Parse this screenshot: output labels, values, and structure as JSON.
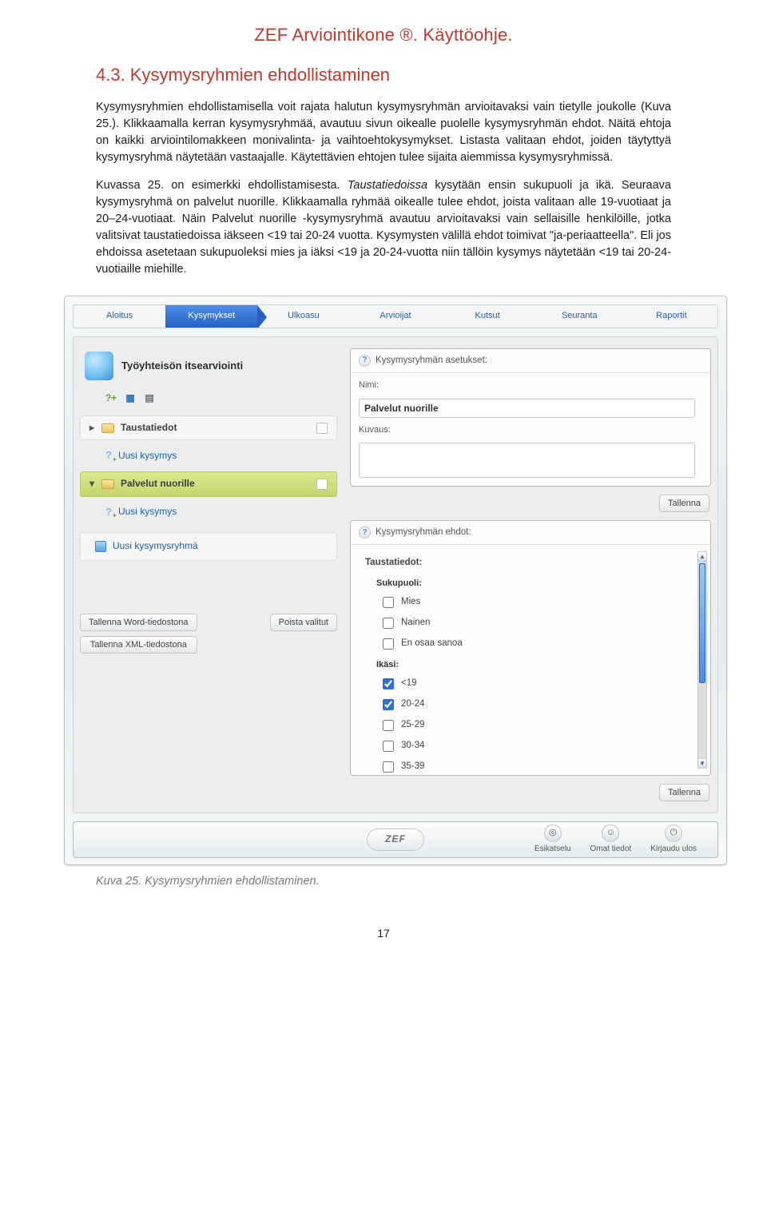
{
  "document": {
    "header": "ZEF Arviointikone ®. Käyttöohje."
  },
  "section": {
    "heading": "4.3. Kysymysryhmien ehdollistaminen",
    "para1": "Kysymysryhmien ehdollistamisella voit rajata halutun kysymysryhmän arvioitavaksi vain tietylle joukolle (Kuva 25.). Klikkaamalla kerran kysymysryhmää, avautuu sivun oikealle puolelle kysymysryhmän ehdot. Näitä ehtoja on kaikki arviointilomakkeen monivalinta- ja vaihtoehtokysymykset. Listasta valitaan ehdot, joiden täytyttyä kysymysryhmä näytetään vastaajalle. Käytettävien ehtojen tulee sijaita aiemmissa kysymysryhmissä.",
    "para2a": "Kuvassa 25. on esimerkki ehdollistamisesta. ",
    "para2_italic": "Taustatiedoissa",
    "para2b": " kysytään ensin sukupuoli ja ikä. Seuraava kysymysryhmä on palvelut nuorille. Klikkaamalla ryhmää oikealle tulee ehdot, joista valitaan alle 19-vuotiaat ja 20–24-vuotiaat. Näin Palvelut nuorille -kysymysryhmä avautuu arvioitavaksi vain sellaisille henkilöille, jotka valitsivat taustatiedoissa iäkseen <19 tai 20-24 vuotta. Kysymysten välillä ehdot toimivat \"ja-periaatteella\". Eli jos ehdoissa asetetaan sukupuoleksi mies ja iäksi <19 ja 20-24-vuotta niin tällöin kysymys näytetään <19 tai 20-24-vuotiaille miehille."
  },
  "screenshot": {
    "tabs": [
      "Aloitus",
      "Kysymykset",
      "Ulkoasu",
      "Arvioijat",
      "Kutsut",
      "Seuranta",
      "Raportit"
    ],
    "activeTab": 1,
    "evaluationTitle": "Työyhteisön itsearviointi",
    "groups": {
      "g1": "Taustatiedot",
      "g2": "Palvelut nuorille"
    },
    "newQuestion": "Uusi kysymys",
    "newGroup": "Uusi kysymysryhmä",
    "buttons": {
      "saveWord": "Tallenna Word-tiedostona",
      "saveXml": "Tallenna XML-tiedostona",
      "deleteSelected": "Poista valitut",
      "save": "Tallenna"
    },
    "settingsPanel": {
      "title": "Kysymysryhmän asetukset:",
      "nameLabel": "Nimi:",
      "nameValue": "Palvelut nuorille",
      "descLabel": "Kuvaus:"
    },
    "conditionsPanel": {
      "title": "Kysymysryhmän ehdot:",
      "sectionLabel": "Taustatiedot:",
      "gender": {
        "label": "Sukupuoli:",
        "options": [
          {
            "label": "Mies",
            "checked": false
          },
          {
            "label": "Nainen",
            "checked": false
          },
          {
            "label": "En osaa sanoa",
            "checked": false
          }
        ]
      },
      "age": {
        "label": "Ikäsi:",
        "options": [
          {
            "label": "<19",
            "checked": true
          },
          {
            "label": "20-24",
            "checked": true
          },
          {
            "label": "25-29",
            "checked": false
          },
          {
            "label": "30-34",
            "checked": false
          },
          {
            "label": "35-39",
            "checked": false
          }
        ]
      }
    },
    "bottom": {
      "brand": "ZEF",
      "actions": [
        "Esikatselu",
        "Omat tiedot",
        "Kirjaudu ulos"
      ]
    }
  },
  "caption": "Kuva 25. Kysymysryhmien ehdollistaminen.",
  "pageNumber": "17"
}
